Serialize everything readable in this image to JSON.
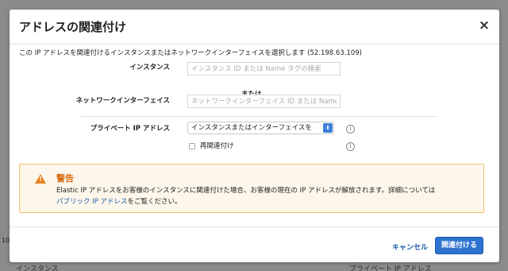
{
  "backdrop": {
    "left_mark": "10",
    "row_label_left": "インスタンス",
    "row_label_right": "プライベート IP アドレス"
  },
  "dialog": {
    "title": "アドレスの関連付け",
    "close_glyph": "×",
    "intro": "この IP アドレスを関連付けるインスタンスまたはネットワークインターフェイスを選択します (52.198.63.109)"
  },
  "form": {
    "instance_label": "インスタンス",
    "instance_placeholder": "インスタンス ID または Name タグの検索",
    "or_label": "または",
    "eni_label": "ネットワークインターフェイス",
    "eni_placeholder": "ネットワークインターフェイス ID または Name",
    "private_ip_label": "プライベート IP アドレス",
    "private_ip_value": "インスタンスまたはインターフェイスを",
    "reassociate_label": "再関連付け",
    "info_glyph": "i",
    "select_arrow_glyph": "⬍",
    "reassociate_checked": false
  },
  "alert": {
    "title": "警告",
    "body": "Elastic IP アドレスをお客様のインスタンスに関連付けた場合、お客様の現在の IP アドレスが解放されます。詳細については",
    "link": "パブリック IP アドレス",
    "body_tail": "をご覧ください。",
    "icon": "warning-icon",
    "icon_glyph": "!"
  },
  "footer": {
    "cancel": "キャンセル",
    "submit": "関連付ける"
  },
  "colors": {
    "primary": "#2f73d1",
    "link": "#1a5ba8",
    "warning": "#e6821e",
    "alert_bg": "#fdf6ea"
  }
}
